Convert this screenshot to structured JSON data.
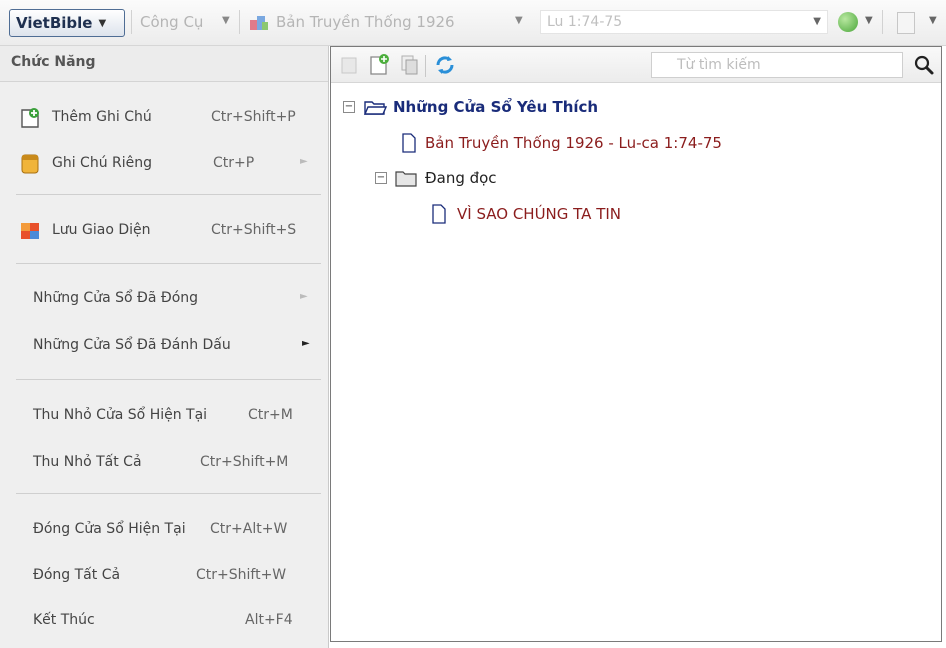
{
  "topbar": {
    "app_button": "VietBible",
    "tools_label": "Công Cụ",
    "bible_version": "Bản Truyền Thống 1926",
    "reference": "Lu 1:74-75"
  },
  "menu": {
    "header": "Chức Năng",
    "items": [
      {
        "label": "Thêm Ghi Chú",
        "shortcut": "Ctr+Shift+P",
        "icon": "add-note-icon"
      },
      {
        "label": "Ghi Chú Riêng",
        "shortcut": "Ctr+P",
        "icon": "notebook-icon"
      },
      {
        "label": "Lưu Giao Diện",
        "shortcut": "Ctr+Shift+S",
        "icon": "save-layout-icon"
      },
      {
        "label": "Những Cửa Sổ Đã Đóng",
        "shortcut": ""
      },
      {
        "label": "Những Cửa Sổ Đã Đánh Dấu",
        "shortcut": ""
      },
      {
        "label": "Thu Nhỏ Cửa Sổ Hiện Tại",
        "shortcut": "Ctr+M"
      },
      {
        "label": "Thu Nhỏ Tất Cả",
        "shortcut": "Ctr+Shift+M"
      },
      {
        "label": "Đóng Cửa Sổ Hiện Tại",
        "shortcut": "Ctr+Alt+W"
      },
      {
        "label": "Đóng Tất Cả",
        "shortcut": "Ctr+Shift+W"
      },
      {
        "label": "Kết Thúc",
        "shortcut": "Alt+F4"
      }
    ]
  },
  "pane": {
    "search_placeholder": "Từ tìm kiếm",
    "tree": {
      "root": "Những Cửa Sổ Yêu Thích",
      "doc1": "Bản Truyền Thống 1926 - Lu-ca 1:74-75",
      "folder": "Đang đọc",
      "doc2": "VÌ SAO CHÚNG TA TIN"
    }
  },
  "colors": {
    "tree_root": "#1a2c7a",
    "tree_item": "#8b1d1d",
    "refresh_icon": "#2a8fd8"
  }
}
